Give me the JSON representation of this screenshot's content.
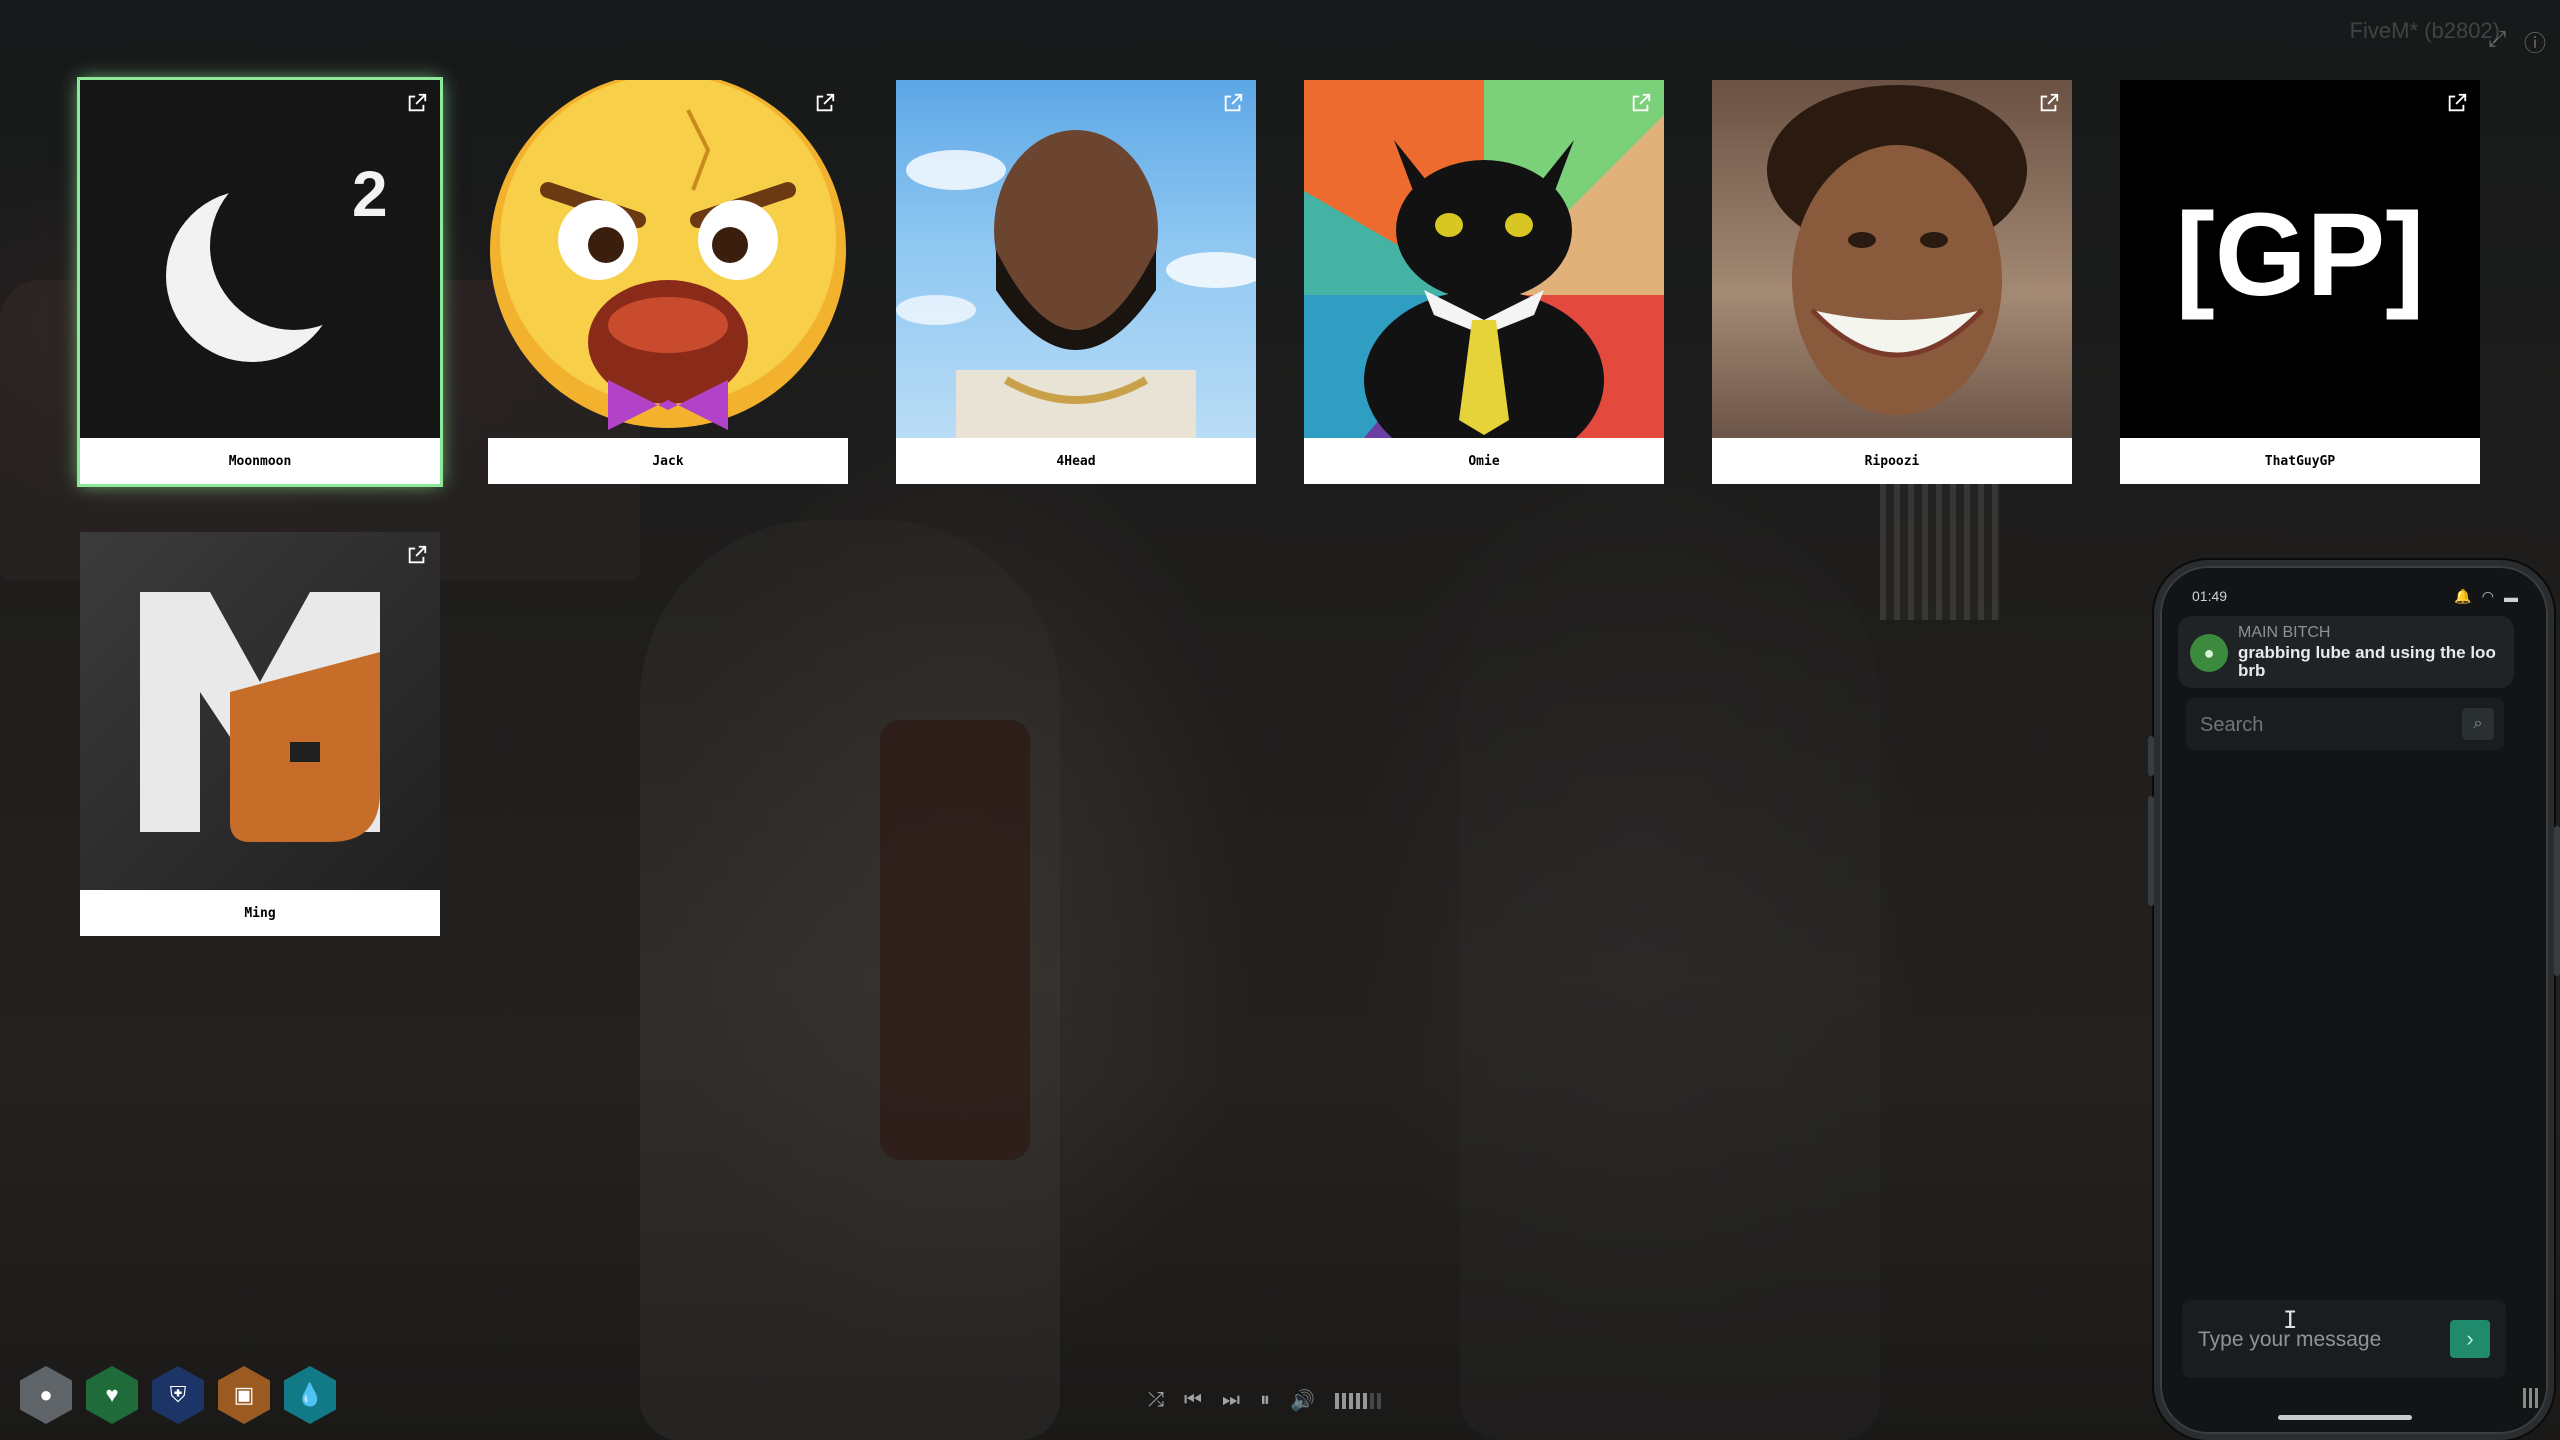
{
  "window": {
    "title": "FiveM* (b2802)"
  },
  "cards": [
    {
      "name": "Moonmoon",
      "selected": true,
      "superscript": "2"
    },
    {
      "name": "Jack"
    },
    {
      "name": "4Head"
    },
    {
      "name": "Omie"
    },
    {
      "name": "Ripoozi"
    },
    {
      "name": "ThatGuyGP",
      "logo_text": "[GP]"
    },
    {
      "name": "Ming",
      "logo_text": "MJ"
    }
  ],
  "phone": {
    "time": "01:49",
    "notification": {
      "sender": "MAIN BITCH",
      "message": "grabbing lube and using the loo brb"
    },
    "search_placeholder": "Search",
    "message_placeholder": "Type your message"
  },
  "hud": {
    "icons": [
      "microphone-icon",
      "health-heart-icon",
      "armor-shield-icon",
      "inventory-box-icon",
      "water-drop-icon"
    ],
    "colors": [
      "#5f6468",
      "#1f6b3a",
      "#1c3566",
      "#9a5a22",
      "#127a86"
    ]
  },
  "music": {
    "volume_level": 0.7
  }
}
